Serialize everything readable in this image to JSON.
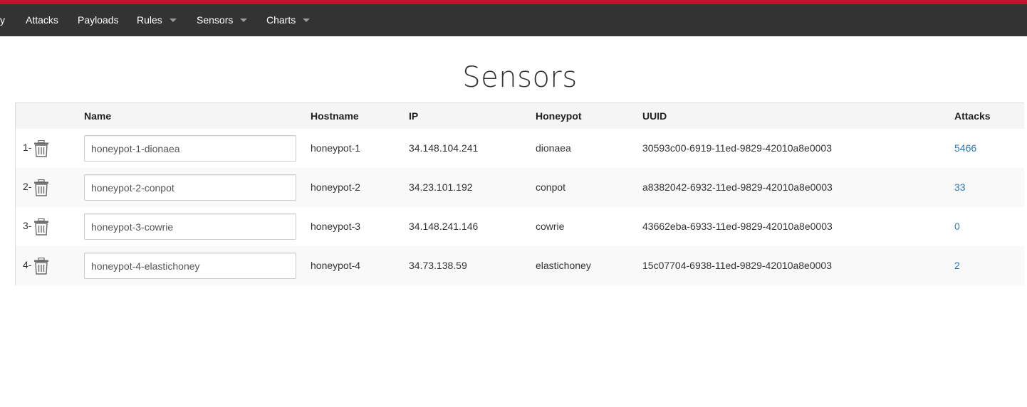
{
  "colors": {
    "top_stripe": "#c8102e",
    "navbar_bg": "#333333",
    "link": "#2a7ab8"
  },
  "nav": {
    "partial_item": "y",
    "items": [
      {
        "label": "Attacks",
        "dropdown": false
      },
      {
        "label": "Payloads",
        "dropdown": false
      },
      {
        "label": "Rules",
        "dropdown": true
      },
      {
        "label": "Sensors",
        "dropdown": true
      },
      {
        "label": "Charts",
        "dropdown": true
      }
    ]
  },
  "page": {
    "title": "Sensors"
  },
  "table": {
    "headers": {
      "name": "Name",
      "hostname": "Hostname",
      "ip": "IP",
      "honeypot": "Honeypot",
      "uuid": "UUID",
      "attacks": "Attacks"
    },
    "rows": [
      {
        "num": "1-",
        "name": "honeypot-1-dionaea",
        "hostname": "honeypot-1",
        "ip": "34.148.104.241",
        "honeypot": "dionaea",
        "uuid": "30593c00-6919-11ed-9829-42010a8e0003",
        "attacks": "5466"
      },
      {
        "num": "2-",
        "name": "honeypot-2-conpot",
        "hostname": "honeypot-2",
        "ip": "34.23.101.192",
        "honeypot": "conpot",
        "uuid": "a8382042-6932-11ed-9829-42010a8e0003",
        "attacks": "33"
      },
      {
        "num": "3-",
        "name": "honeypot-3-cowrie",
        "hostname": "honeypot-3",
        "ip": "34.148.241.146",
        "honeypot": "cowrie",
        "uuid": "43662eba-6933-11ed-9829-42010a8e0003",
        "attacks": "0"
      },
      {
        "num": "4-",
        "name": "honeypot-4-elastichoney",
        "hostname": "honeypot-4",
        "ip": "34.73.138.59",
        "honeypot": "elastichoney",
        "uuid": "15c07704-6938-11ed-9829-42010a8e0003",
        "attacks": "2"
      }
    ]
  }
}
